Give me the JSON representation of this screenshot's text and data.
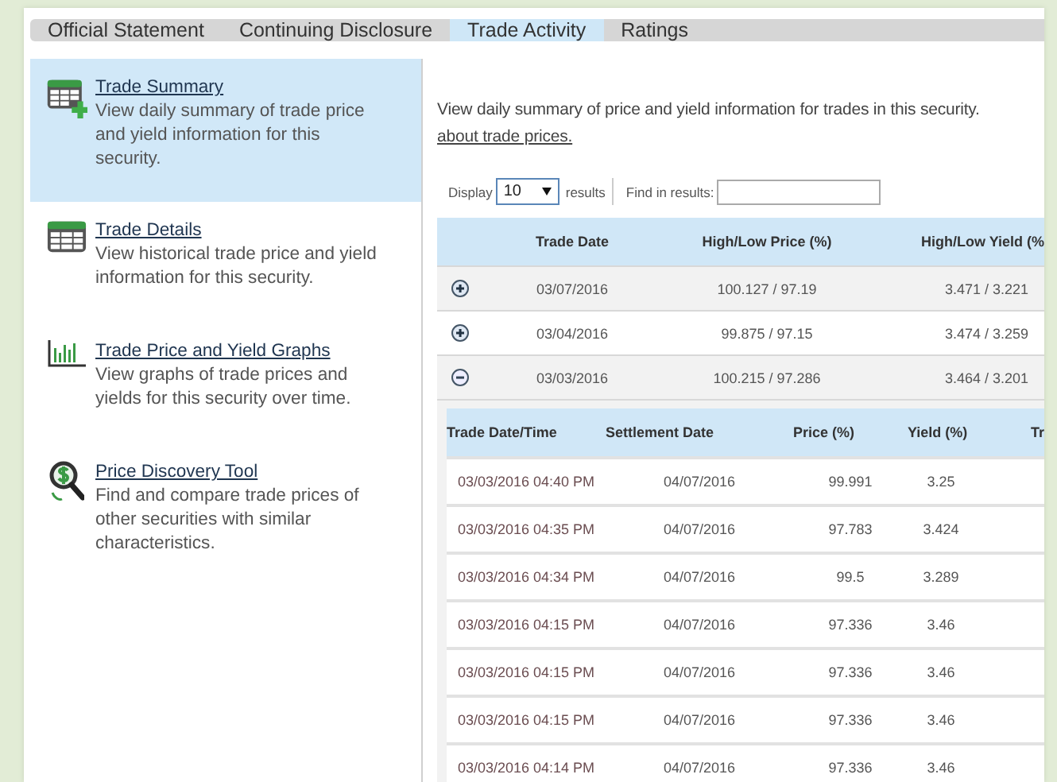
{
  "tabs": [
    {
      "label": "Official Statement",
      "selected": false
    },
    {
      "label": "Continuing Disclosure",
      "selected": false
    },
    {
      "label": "Trade Activity",
      "selected": true
    },
    {
      "label": "Ratings",
      "selected": false
    }
  ],
  "sidebar": {
    "items": [
      {
        "kind": "summary",
        "title": "Trade Summary",
        "description": "View daily summary of trade price and yield information for this security.",
        "selected": true
      },
      {
        "kind": "details",
        "title": "Trade Details",
        "description": "View historical trade price and yield information for this security.",
        "selected": false
      },
      {
        "kind": "graphs",
        "title": "Trade Price and Yield Graphs",
        "description": "View graphs of trade prices and yields for this security over time.",
        "selected": false
      },
      {
        "kind": "discovery",
        "title": "Price Discovery Tool",
        "description": "Find and compare trade prices of other securities with similar characteristics.",
        "selected": false
      }
    ]
  },
  "intro": {
    "text": "View daily summary of price and yield information for trades in this security.",
    "link": "about trade prices."
  },
  "toolbar": {
    "display_label": "Display",
    "display_value": "10",
    "display_suffix": "results",
    "find_label": "Find in results:"
  },
  "summary_table": {
    "columns": [
      "Trade Date",
      "High/Low Price (%)",
      "High/Low Yield (%"
    ],
    "rows": [
      {
        "expanded": false,
        "trade_date": "03/07/2016",
        "price": "100.127 / 97.19",
        "yield": "3.471 / 3.221"
      },
      {
        "expanded": false,
        "trade_date": "03/04/2016",
        "price": "99.875 / 97.15",
        "yield": "3.474 / 3.259"
      },
      {
        "expanded": true,
        "trade_date": "03/03/2016",
        "price": "100.215 / 97.286",
        "yield": "3.464 / 3.201"
      }
    ]
  },
  "detail_table": {
    "columns": [
      "Trade Date/Time",
      "Settlement Date",
      "Price (%)",
      "Yield (%)",
      "Tr"
    ],
    "rows": [
      [
        "03/03/2016 04:40 PM",
        "04/07/2016",
        "99.991",
        "3.25"
      ],
      [
        "03/03/2016 04:35 PM",
        "04/07/2016",
        "97.783",
        "3.424"
      ],
      [
        "03/03/2016 04:34 PM",
        "04/07/2016",
        "99.5",
        "3.289"
      ],
      [
        "03/03/2016 04:15 PM",
        "04/07/2016",
        "97.336",
        "3.46"
      ],
      [
        "03/03/2016 04:15 PM",
        "04/07/2016",
        "97.336",
        "3.46"
      ],
      [
        "03/03/2016 04:15 PM",
        "04/07/2016",
        "97.336",
        "3.46"
      ],
      [
        "03/03/2016 04:14 PM",
        "04/07/2016",
        "97.336",
        "3.46"
      ]
    ]
  }
}
